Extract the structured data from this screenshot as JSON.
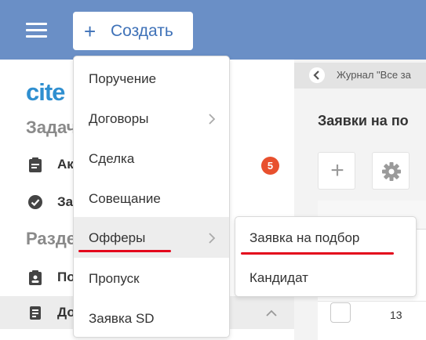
{
  "header": {
    "create_label": "Создать"
  },
  "sidebar": {
    "logo_text": "cite",
    "section_tasks": "Задач",
    "section_sections": "Разде",
    "items": [
      {
        "label": "Ак",
        "icon": "clipboard-icon"
      },
      {
        "label": "За",
        "icon": "check-circle-icon"
      },
      {
        "label": "По",
        "icon": "clipboard-user-icon"
      },
      {
        "label": "До",
        "icon": "document-icon"
      }
    ],
    "badge_count": "5"
  },
  "content": {
    "breadcrumb": "Журнал \"Все за",
    "page_title": "Заявки на по",
    "row_number": "13"
  },
  "dropdown": {
    "items": [
      {
        "label": "Поручение",
        "has_submenu": false
      },
      {
        "label": "Договоры",
        "has_submenu": true
      },
      {
        "label": "Сделка",
        "has_submenu": false
      },
      {
        "label": "Совещание",
        "has_submenu": false
      },
      {
        "label": "Офферы",
        "has_submenu": true,
        "highlighted": true
      },
      {
        "label": "Пропуск",
        "has_submenu": false
      },
      {
        "label": "Заявка SD",
        "has_submenu": false
      }
    ]
  },
  "submenu": {
    "items": [
      {
        "label": "Заявка на подбор"
      },
      {
        "label": "Кандидат"
      }
    ]
  },
  "colors": {
    "topbar": "#6a8fc6",
    "accent": "#3f72b8",
    "badge": "#e8502e",
    "annotation": "#e3071c"
  }
}
